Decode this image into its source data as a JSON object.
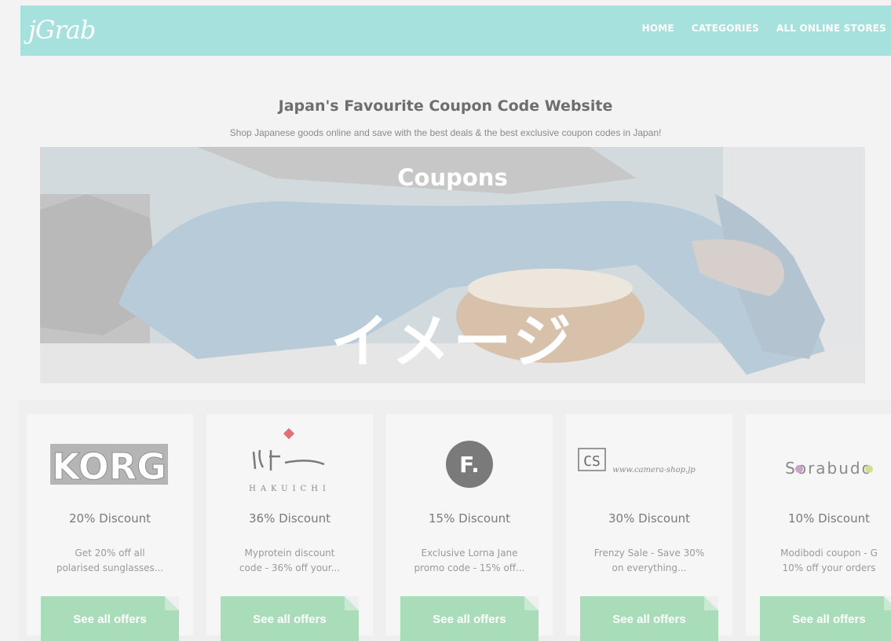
{
  "header": {
    "logo": "jGrab",
    "nav": [
      "HOME",
      "CATEGORIES",
      "ALL ONLINE STORES"
    ]
  },
  "hero": {
    "title": "Japan's Favourite Coupon Code Website",
    "subtitle": "Shop Japanese goods online and save with the best deals & the best exclusive coupon codes in Japan!"
  },
  "banner": {
    "label": "Coupons",
    "overlay": "イメージ"
  },
  "cards": [
    {
      "logo": "KORG",
      "discount": "20% Discount",
      "desc_line1": "Get 20% off all",
      "desc_line2": "polarised sunglasses...",
      "button": "See all offers"
    },
    {
      "logo": "HAKUICHI",
      "discount": "36% Discount",
      "desc_line1": "Myprotein discount",
      "desc_line2": "code - 36% off your...",
      "button": "See all offers"
    },
    {
      "logo": "F.",
      "discount": "15% Discount",
      "desc_line1": "Exclusive Lorna Jane",
      "desc_line2": "promo code - 15% off...",
      "button": "See all offers"
    },
    {
      "logo": "CS",
      "logo_sub": "www.camera-shop.jp",
      "discount": "30% Discount",
      "desc_line1": "Frenzy Sale - Save 30%",
      "desc_line2": "on everything...",
      "button": "See all offers"
    },
    {
      "logo": "Sorabudo",
      "discount": "10% Discount",
      "desc_line1": "Modibodi coupon - G",
      "desc_line2": "10% off your orders",
      "button": "See all offers"
    }
  ],
  "colors": {
    "header": "#a6e1dd",
    "button": "#a9dcb9",
    "background": "#f3f3f3"
  }
}
